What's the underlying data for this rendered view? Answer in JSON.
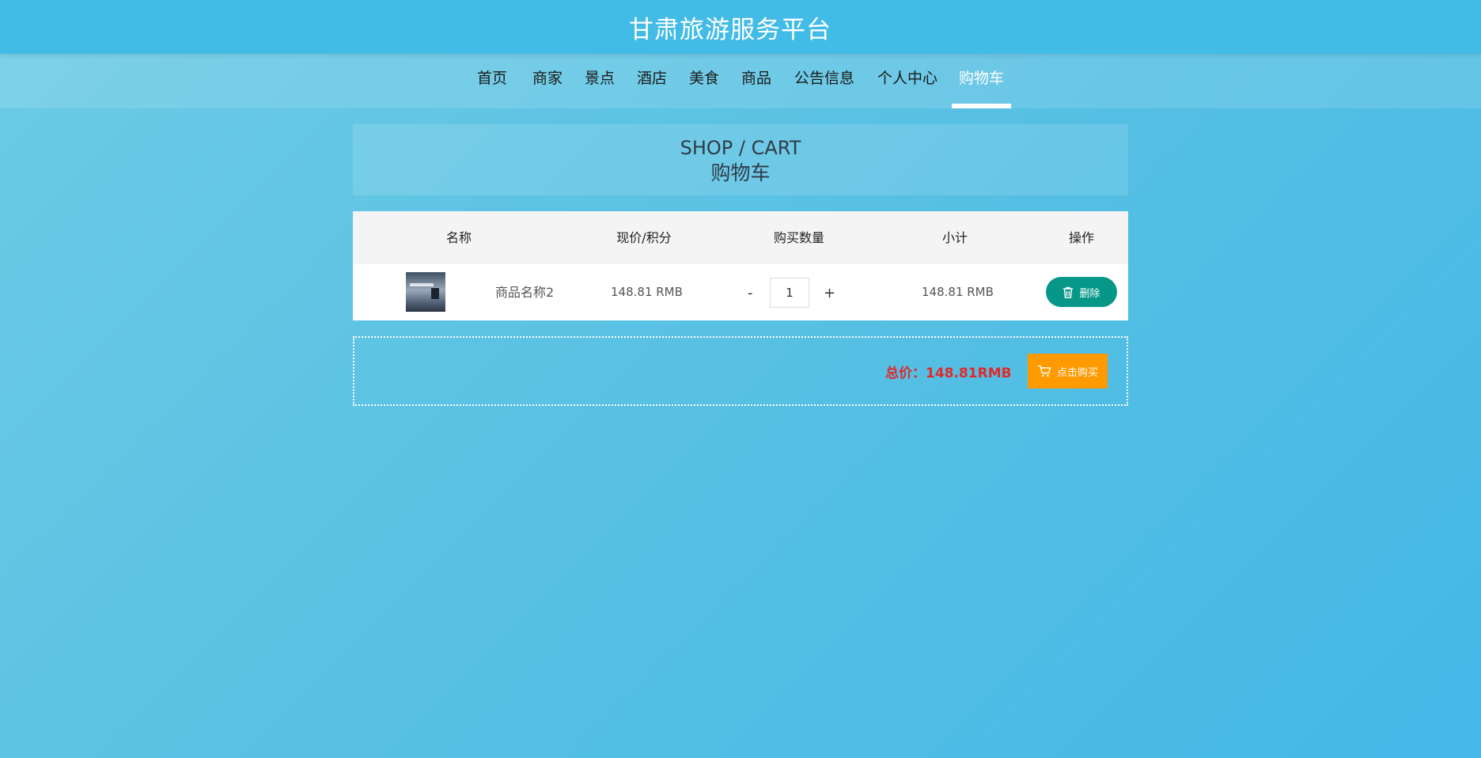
{
  "header": {
    "title": "甘肃旅游服务平台"
  },
  "nav": {
    "items": [
      {
        "label": "首页"
      },
      {
        "label": "商家"
      },
      {
        "label": "景点"
      },
      {
        "label": "酒店"
      },
      {
        "label": "美食"
      },
      {
        "label": "商品"
      },
      {
        "label": "公告信息"
      },
      {
        "label": "个人中心"
      },
      {
        "label": "购物车",
        "active": true
      }
    ]
  },
  "page": {
    "title_en": "SHOP / CART",
    "title_cn": "购物车"
  },
  "table": {
    "headers": [
      "名称",
      "现价/积分",
      "购买数量",
      "小计",
      "操作"
    ],
    "rows": [
      {
        "name": "商品名称2",
        "price": "148.81 RMB",
        "quantity": "1",
        "subtotal": "148.81 RMB",
        "delete_label": "删除",
        "delete_icon": "trash-icon",
        "thumbnail_icon": "product-thumbnail"
      }
    ],
    "minus_label": "-",
    "plus_label": "+"
  },
  "summary": {
    "total": "总价：148.81RMB",
    "buy_label": "点击购买",
    "buy_icon": "cart-icon"
  },
  "colors": {
    "header_bg": "#43bbe7",
    "delete_button": "#079789",
    "buy_button": "#ff9a00",
    "total_text": "#e1292b"
  }
}
